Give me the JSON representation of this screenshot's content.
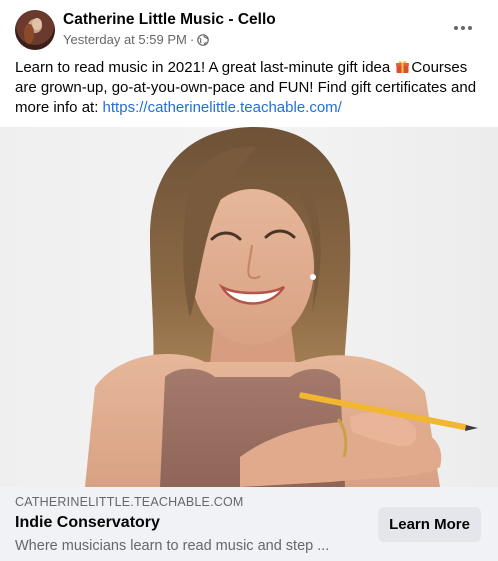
{
  "post": {
    "page_name": "Catherine Little Music - Cello",
    "timestamp": "Yesterday at 5:59 PM",
    "separator": "·",
    "audience_icon": "globe-icon",
    "more_icon": "more-options-icon",
    "text_part1": "Learn to read music in 2021! A great last-minute gift idea ",
    "gift_icon": "gift-emoji",
    "text_part2": "Courses are grown-up, go-at-you-own-pace and FUN! Find gift certificates and more info at: ",
    "link": "https://catherinelittle.teachable.com/"
  },
  "preview": {
    "domain": "CATHERINELITTLE.TEACHABLE.COM",
    "title": "Indie Conservatory",
    "description": "Where musicians learn to read music and step ...",
    "cta_label": "Learn More"
  },
  "colors": {
    "link": "#216fdb",
    "secondary_text": "#65676b",
    "preview_bg": "#f0f2f5",
    "button_bg": "#e4e6eb"
  }
}
